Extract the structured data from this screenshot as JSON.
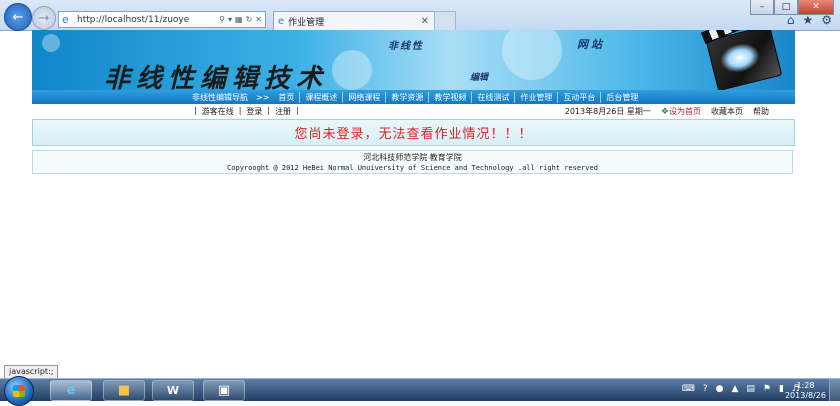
{
  "browser": {
    "address": "http://localhost/11/zuoye",
    "tab_title": "作业管理"
  },
  "banner": {
    "main_title": "非线性编辑技术",
    "small_text_1": "非线性",
    "small_text_2": "网站",
    "small_text_3": "编辑"
  },
  "nav": {
    "label": "非线性编辑导航",
    "arrow": ">>",
    "items": [
      "首页",
      "课程概述",
      "网络课程",
      "教学资源",
      "教学视频",
      "在线测试",
      "作业管理",
      "互动平台",
      "后台管理"
    ]
  },
  "subbar": {
    "guest": "游客在线",
    "login": "登录",
    "register": "注册",
    "date": "2013年8月26日 星期一",
    "home": "设为首页",
    "bookmark": "收藏本页",
    "help": "帮助"
  },
  "warning": "您尚未登录，无法查看作业情况！！！",
  "footer": {
    "line1": "河北科技师范学院  教育学院",
    "line2": "Copyrooght @ 2012 HeBei Normal Unuiversity of Science and Technology .all right reserved"
  },
  "status_text": "javascript:;",
  "taskbar": {
    "time": "1:28",
    "date": "2013/8/26"
  }
}
